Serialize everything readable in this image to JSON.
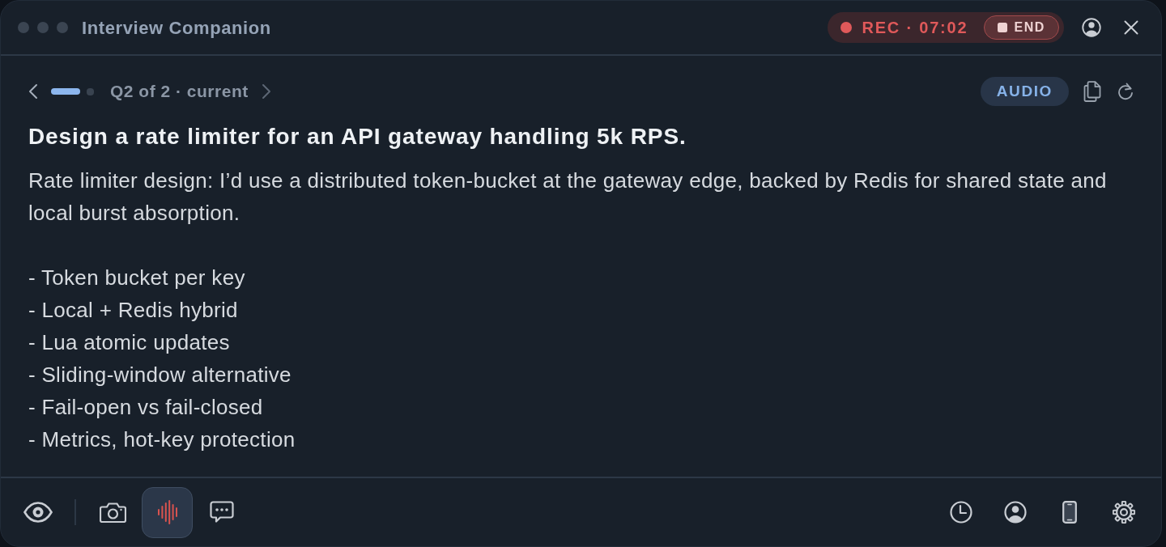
{
  "window": {
    "title": "Interview Companion"
  },
  "recording": {
    "label": "REC · 07:02",
    "end_button": "END"
  },
  "question_nav": {
    "pager": [
      {
        "selected": true
      },
      {
        "selected": false
      }
    ],
    "label": "Q2 of 2 · current",
    "source_badge": "AUDIO"
  },
  "question": {
    "title": "Design a rate limiter for an API gateway handling 5k RPS."
  },
  "answer": {
    "summary": "Rate limiter design: I’d use a distributed token-bucket at the gateway edge, backed by Redis for shared state and local burst absorption.",
    "bullets": [
      "- Token bucket per key",
      "- Local + Redis hybrid",
      "- Lua atomic updates",
      "- Sliding-window alternative",
      "- Fail-open vs fail-closed",
      "- Metrics, hot-key protection"
    ]
  },
  "toolbar": {
    "left": [
      {
        "selected": false
      },
      {
        "selected": false
      },
      {
        "selected": true
      },
      {
        "selected": false
      }
    ]
  }
}
